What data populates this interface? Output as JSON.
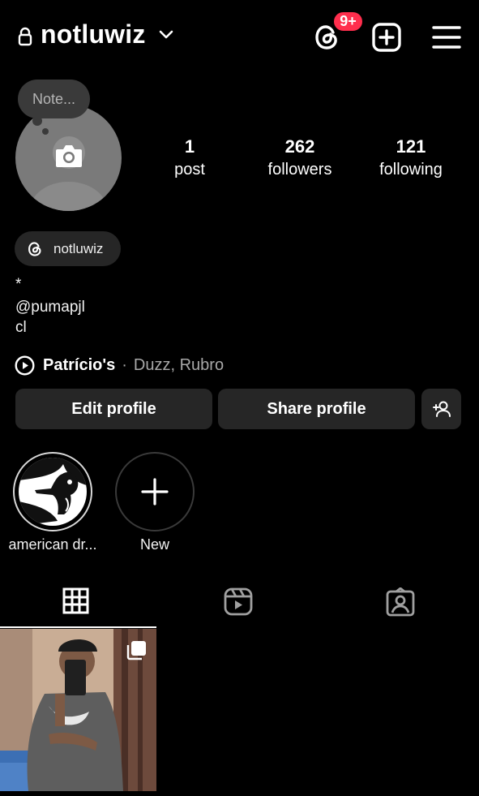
{
  "header": {
    "username": "notluwiz",
    "threads_badge": "9+",
    "icons": {
      "lock": "lock-icon",
      "chevron": "chevron-down-icon",
      "threads": "threads-icon",
      "create": "plus-square-icon",
      "menu": "hamburger-menu-icon"
    }
  },
  "profile": {
    "note_placeholder": "Note...",
    "stats": [
      {
        "value": "1",
        "label": "post"
      },
      {
        "value": "262",
        "label": "followers"
      },
      {
        "value": "121",
        "label": "following"
      }
    ],
    "threads_chip": "notluwiz",
    "bio_lines": [
      "*",
      "@pumapjl",
      "cl"
    ],
    "music": {
      "title": "Patrício's",
      "separator": "·",
      "artist": "Duzz, Rubro"
    }
  },
  "actions": {
    "edit_profile": "Edit profile",
    "share_profile": "Share profile",
    "discover_icon": "add-person-icon"
  },
  "highlights": [
    {
      "label": "american dr..."
    },
    {
      "label": "New"
    }
  ],
  "tabs": [
    "grid-icon",
    "reels-icon",
    "tagged-icon"
  ],
  "posts": [
    {
      "type": "carousel"
    }
  ]
}
